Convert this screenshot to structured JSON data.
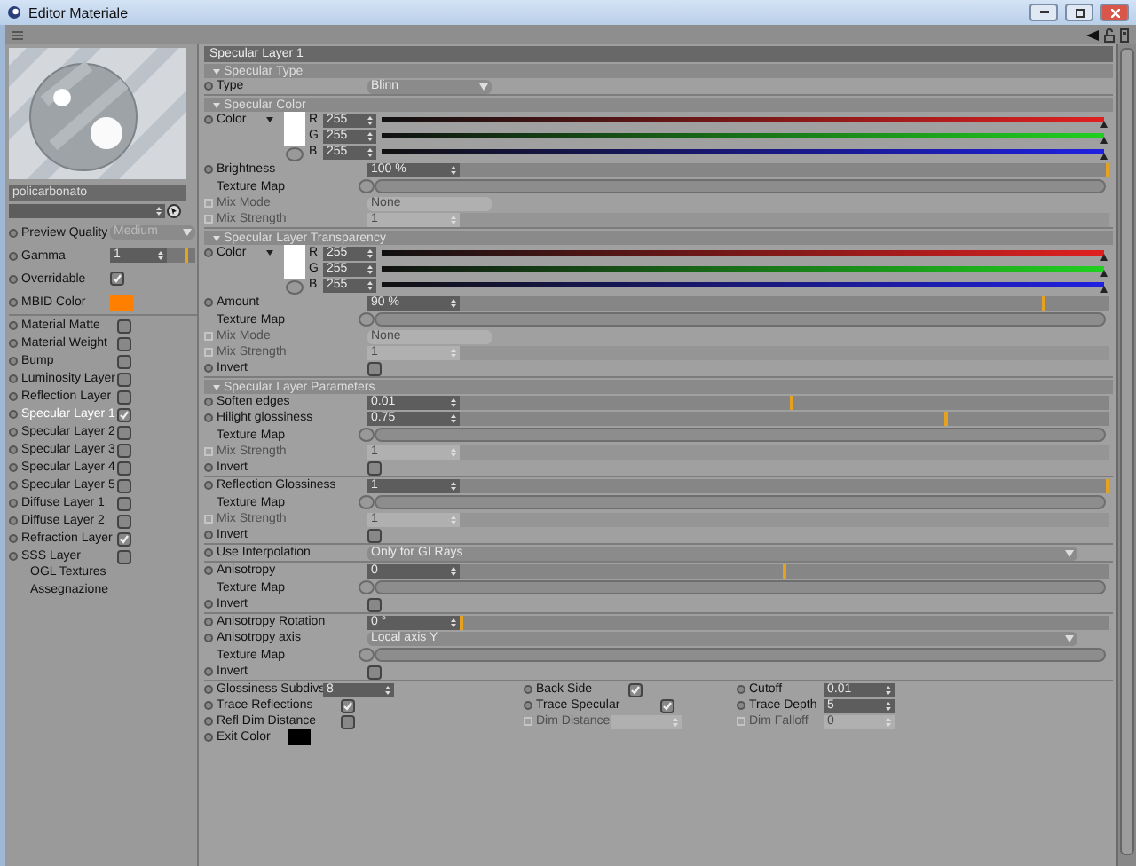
{
  "window": {
    "title": "Editor Materiale"
  },
  "preview": {
    "name": "policarbonato"
  },
  "left_params": [
    {
      "kind": "dropdown",
      "label": "Preview Quality",
      "value": "Medium"
    },
    {
      "kind": "number",
      "label": "Gamma",
      "value": "1",
      "level": 0.68
    },
    {
      "kind": "check",
      "label": "Overridable",
      "checked": true
    },
    {
      "kind": "color",
      "label": "MBID Color",
      "color": "#ff8000"
    }
  ],
  "channels": [
    {
      "label": "Material Matte",
      "checked": false,
      "selected": false
    },
    {
      "label": "Material Weight",
      "checked": false,
      "selected": false
    },
    {
      "label": "Bump",
      "checked": false,
      "selected": false
    },
    {
      "label": "Luminosity Layer",
      "checked": false,
      "selected": false
    },
    {
      "label": "Reflection Layer",
      "checked": false,
      "selected": false
    },
    {
      "label": "Specular Layer 1",
      "checked": true,
      "selected": true
    },
    {
      "label": "Specular Layer 2",
      "checked": false,
      "selected": false
    },
    {
      "label": "Specular Layer 3",
      "checked": false,
      "selected": false
    },
    {
      "label": "Specular Layer 4",
      "checked": false,
      "selected": false
    },
    {
      "label": "Specular Layer 5",
      "checked": false,
      "selected": false
    },
    {
      "label": "Diffuse Layer 1",
      "checked": false,
      "selected": false
    },
    {
      "label": "Diffuse Layer 2",
      "checked": false,
      "selected": false
    },
    {
      "label": "Refraction Layer",
      "checked": true,
      "selected": false
    },
    {
      "label": "SSS Layer",
      "checked": false,
      "selected": false
    }
  ],
  "links": [
    "OGL Textures",
    "Assegnazione"
  ],
  "header": "Specular Layer 1",
  "sections": [
    {
      "title": "Specular Type",
      "groups": [
        [
          {
            "kind": "dropdown",
            "label": "Type",
            "value": "Blinn",
            "disabled": false
          }
        ]
      ]
    },
    {
      "title": "Specular Color",
      "groups": [
        [
          {
            "kind": "color",
            "label": "Color",
            "channels": [
              {
                "name": "R",
                "value": "255",
                "level": 1
              },
              {
                "name": "G",
                "value": "255",
                "level": 1
              },
              {
                "name": "B",
                "value": "255",
                "level": 1
              }
            ]
          },
          {
            "kind": "slider",
            "label": "Brightness",
            "value": "100 %",
            "level": 1,
            "disabled": false
          },
          {
            "kind": "texture",
            "label": "Texture Map"
          },
          {
            "kind": "dropdown",
            "label": "Mix Mode",
            "value": "None",
            "disabled": true
          },
          {
            "kind": "slider",
            "label": "Mix Strength",
            "value": "1",
            "disabled": true
          }
        ]
      ]
    },
    {
      "title": "Specular Layer Transparency",
      "groups": [
        [
          {
            "kind": "color",
            "label": "Color",
            "channels": [
              {
                "name": "R",
                "value": "255",
                "level": 1
              },
              {
                "name": "G",
                "value": "255",
                "level": 1
              },
              {
                "name": "B",
                "value": "255",
                "level": 1
              }
            ]
          },
          {
            "kind": "slider",
            "label": "Amount",
            "value": "90 %",
            "level": 0.9,
            "disabled": false
          },
          {
            "kind": "texture",
            "label": "Texture Map"
          },
          {
            "kind": "dropdown",
            "label": "Mix Mode",
            "value": "None",
            "disabled": true
          },
          {
            "kind": "slider",
            "label": "Mix Strength",
            "value": "1",
            "disabled": true
          },
          {
            "kind": "check",
            "label": "Invert",
            "checked": false
          }
        ]
      ]
    },
    {
      "title": "Specular Layer Parameters",
      "groups": [
        [
          {
            "kind": "slider",
            "label": "Soften edges",
            "value": "0.01",
            "level": 0.51,
            "disabled": false
          },
          {
            "kind": "slider",
            "label": "Hilight glossiness",
            "value": "0.75",
            "level": 0.75,
            "disabled": false
          },
          {
            "kind": "texture",
            "label": "Texture Map"
          },
          {
            "kind": "slider",
            "label": "Mix Strength",
            "value": "1",
            "disabled": true
          },
          {
            "kind": "check",
            "label": "Invert",
            "checked": false
          }
        ],
        [
          {
            "kind": "slider",
            "label": "Reflection Glossiness",
            "value": "1",
            "level": 1,
            "disabled": false
          },
          {
            "kind": "texture",
            "label": "Texture Map"
          },
          {
            "kind": "slider",
            "label": "Mix Strength",
            "value": "1",
            "disabled": true
          },
          {
            "kind": "check",
            "label": "Invert",
            "checked": false
          }
        ],
        [
          {
            "kind": "dropdown",
            "label": "Use Interpolation",
            "value": "Only for GI Rays",
            "disabled": false
          }
        ],
        [
          {
            "kind": "slider",
            "label": "Anisotropy",
            "value": "0",
            "level": 0.5,
            "disabled": false
          },
          {
            "kind": "texture",
            "label": "Texture Map"
          },
          {
            "kind": "check",
            "label": "Invert",
            "checked": false
          }
        ],
        [
          {
            "kind": "slider",
            "label": "Anisotropy Rotation",
            "value": "0 °",
            "level": 0,
            "disabled": false
          },
          {
            "kind": "dropdown",
            "label": "Anisotropy axis",
            "value": "Local axis Y",
            "disabled": false
          },
          {
            "kind": "texture",
            "label": "Texture Map"
          },
          {
            "kind": "check",
            "label": "Invert",
            "checked": false
          }
        ]
      ]
    }
  ],
  "options": [
    {
      "kind": "number",
      "label": "Glossiness Subdivs",
      "value": "8",
      "disabled": false
    },
    {
      "kind": "check",
      "label": "Back Side",
      "checked": true
    },
    {
      "kind": "number",
      "label": "Cutoff",
      "value": "0.01",
      "disabled": false
    },
    {
      "kind": "check",
      "label": "Trace Reflections",
      "checked": true
    },
    {
      "kind": "check",
      "label": "Trace Specular",
      "checked": true
    },
    {
      "kind": "number",
      "label": "Trace Depth",
      "value": "5",
      "disabled": false
    },
    {
      "kind": "check",
      "label": "Refl Dim Distance",
      "checked": false
    },
    {
      "kind": "number",
      "label": "Dim Distance",
      "disabled": true
    },
    {
      "kind": "number",
      "label": "Dim Falloff",
      "value": "0",
      "disabled": true
    },
    {
      "kind": "color",
      "label": "Exit Color"
    }
  ]
}
